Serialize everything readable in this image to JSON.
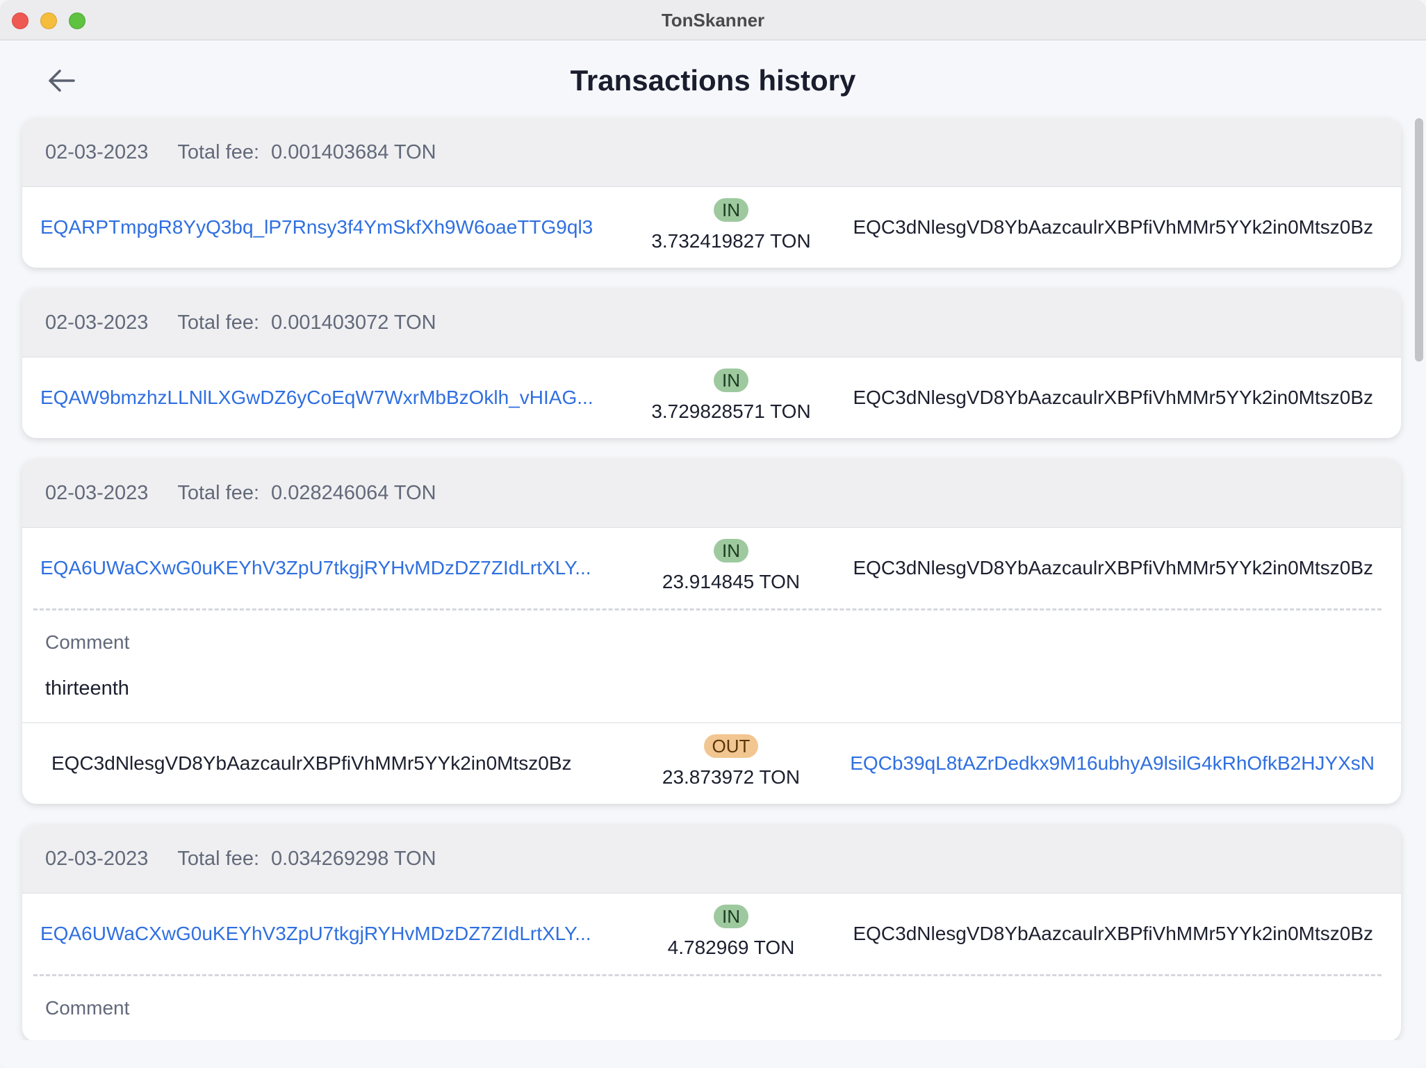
{
  "app": {
    "title": "TonSkanner"
  },
  "page": {
    "title": "Transactions history"
  },
  "labels": {
    "total_fee": "Total fee:",
    "comment": "Comment"
  },
  "colors": {
    "link": "#2f6fe0",
    "in_badge": "#9ec99f",
    "out_badge": "#f2c690"
  },
  "transactions": [
    {
      "date": "02-03-2023",
      "fee": "0.001403684 TON",
      "rows": [
        {
          "from": "EQARPTmpgR8YyQ3bq_lP7Rnsy3f4YmSkfXh9W6oaeTTG9ql3",
          "direction": "IN",
          "amount": "3.732419827 TON",
          "to": "EQC3dNlesgVD8YbAazcaulrXBPfiVhMMr5YYk2in0Mtsz0Bz"
        }
      ]
    },
    {
      "date": "02-03-2023",
      "fee": "0.001403072 TON",
      "rows": [
        {
          "from": "EQAW9bmzhzLLNlLXGwDZ6yCoEqW7WxrMbBzOklh_vHIAG...",
          "direction": "IN",
          "amount": "3.729828571 TON",
          "to": "EQC3dNlesgVD8YbAazcaulrXBPfiVhMMr5YYk2in0Mtsz0Bz"
        }
      ]
    },
    {
      "date": "02-03-2023",
      "fee": "0.028246064 TON",
      "rows": [
        {
          "from": "EQA6UWaCXwG0uKEYhV3ZpU7tkgjRYHvMDzDZ7ZIdLrtXLY...",
          "direction": "IN",
          "amount": "23.914845 TON",
          "to": "EQC3dNlesgVD8YbAazcaulrXBPfiVhMMr5YYk2in0Mtsz0Bz"
        }
      ],
      "comment": "thirteenth",
      "out_row": {
        "from": "EQC3dNlesgVD8YbAazcaulrXBPfiVhMMr5YYk2in0Mtsz0Bz",
        "direction": "OUT",
        "amount": "23.873972 TON",
        "to": "EQCb39qL8tAZrDedkx9M16ubhyA9lsilG4kRhOfkB2HJYXsN"
      }
    },
    {
      "date": "02-03-2023",
      "fee": "0.034269298 TON",
      "rows": [
        {
          "from": "EQA6UWaCXwG0uKEYhV3ZpU7tkgjRYHvMDzDZ7ZIdLrtXLY...",
          "direction": "IN",
          "amount": "4.782969 TON",
          "to": "EQC3dNlesgVD8YbAazcaulrXBPfiVhMMr5YYk2in0Mtsz0Bz"
        }
      ]
    }
  ]
}
